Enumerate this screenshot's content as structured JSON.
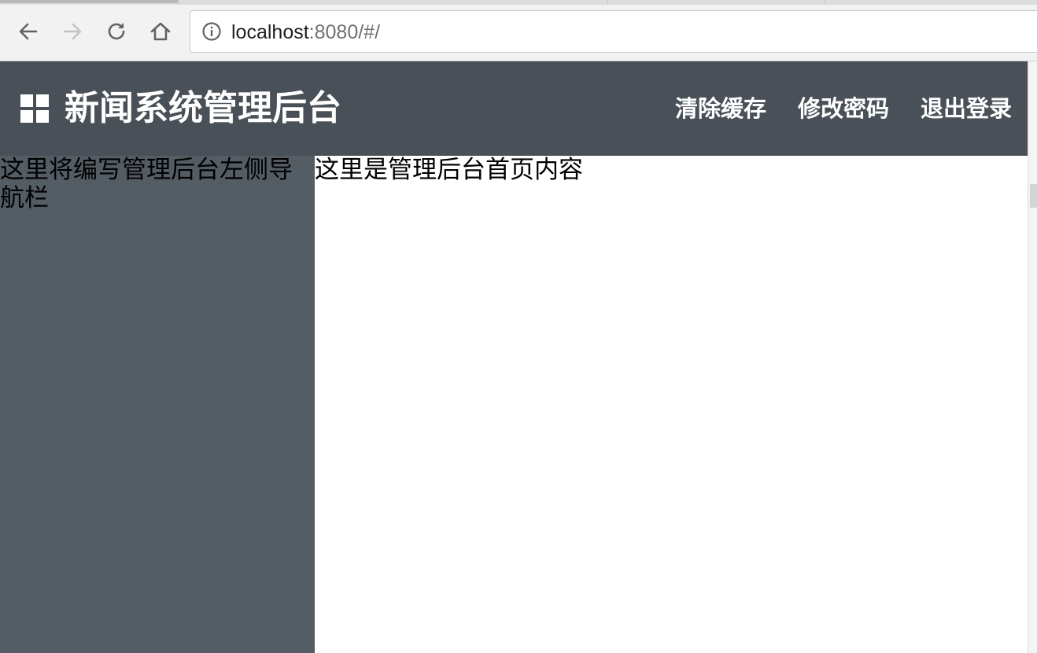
{
  "browser": {
    "address_bar": {
      "host": "localhost",
      "rest": ":8080/#/"
    },
    "icons": {
      "back": "arrow-left-icon",
      "forward": "arrow-right-icon",
      "reload": "reload-icon",
      "home": "home-icon",
      "site_info": "info-icon"
    }
  },
  "header": {
    "logo_icon": "grid-icon",
    "title": "新闻系统管理后台",
    "actions": {
      "clear_cache": "清除缓存",
      "change_password": "修改密码",
      "logout": "退出登录"
    }
  },
  "sidebar": {
    "text": "这里将编写管理后台左侧导航栏"
  },
  "main": {
    "text": "这里是管理后台首页内容"
  },
  "colors": {
    "header_bg": "#4a5058",
    "sidebar_bg": "#545c64",
    "header_text": "#ffffff"
  }
}
